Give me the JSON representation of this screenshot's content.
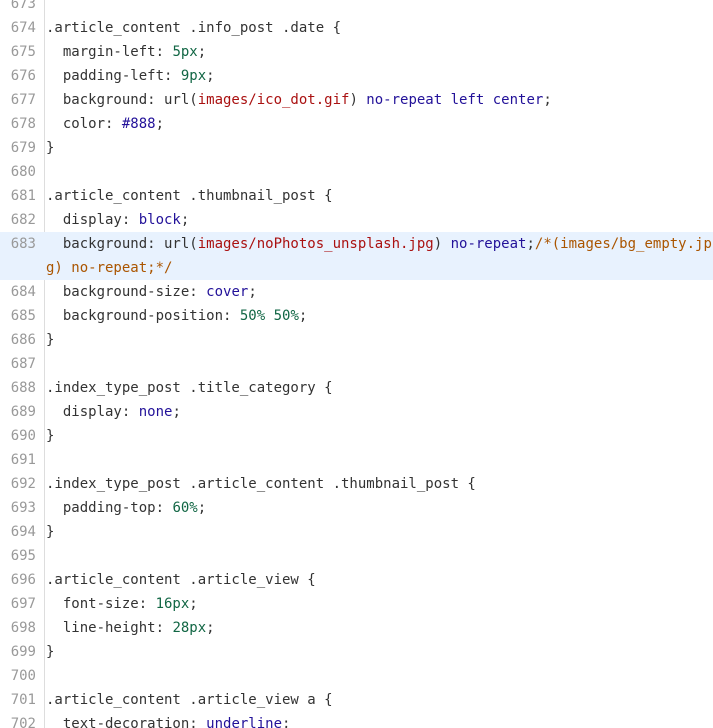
{
  "editor": {
    "colors": {
      "background": "#ffffff",
      "gutter_text": "#999999",
      "active_line": "#e8f2fe",
      "text": "#333333",
      "number": "#116644",
      "keyword": "#221199",
      "string": "#aa1111",
      "comment": "#aa5500"
    },
    "active_line_number": "683",
    "lines": [
      {
        "n": "673",
        "tokens": []
      },
      {
        "n": "674",
        "tokens": [
          {
            "t": ".article_content .info_post .date {",
            "c": "sel"
          }
        ]
      },
      {
        "n": "675",
        "tokens": [
          {
            "t": "  margin-left: ",
            "c": "prop"
          },
          {
            "t": "5px",
            "c": "num"
          },
          {
            "t": ";",
            "c": "punct"
          }
        ]
      },
      {
        "n": "676",
        "tokens": [
          {
            "t": "  padding-left: ",
            "c": "prop"
          },
          {
            "t": "9px",
            "c": "num"
          },
          {
            "t": ";",
            "c": "punct"
          }
        ]
      },
      {
        "n": "677",
        "tokens": [
          {
            "t": "  background: url(",
            "c": "prop"
          },
          {
            "t": "images/ico_dot.gif",
            "c": "str"
          },
          {
            "t": ") ",
            "c": "punct"
          },
          {
            "t": "no-repeat left center",
            "c": "kw"
          },
          {
            "t": ";",
            "c": "punct"
          }
        ]
      },
      {
        "n": "678",
        "tokens": [
          {
            "t": "  color: ",
            "c": "prop"
          },
          {
            "t": "#888",
            "c": "kw"
          },
          {
            "t": ";",
            "c": "punct"
          }
        ]
      },
      {
        "n": "679",
        "tokens": [
          {
            "t": "}",
            "c": "punct"
          }
        ]
      },
      {
        "n": "680",
        "tokens": []
      },
      {
        "n": "681",
        "tokens": [
          {
            "t": ".article_content .thumbnail_post {",
            "c": "sel"
          }
        ]
      },
      {
        "n": "682",
        "tokens": [
          {
            "t": "  display: ",
            "c": "prop"
          },
          {
            "t": "block",
            "c": "kw"
          },
          {
            "t": ";",
            "c": "punct"
          }
        ]
      },
      {
        "n": "683",
        "tokens": [
          {
            "t": "  background: url(",
            "c": "prop"
          },
          {
            "t": "images/noPhotos_unsplash.jpg",
            "c": "str"
          },
          {
            "t": ") ",
            "c": "punct"
          },
          {
            "t": "no-repeat",
            "c": "kw"
          },
          {
            "t": ";",
            "c": "punct"
          },
          {
            "t": "/*(images/bg_empty.jpg) no-repeat;*/",
            "c": "com"
          }
        ]
      },
      {
        "n": "684",
        "tokens": [
          {
            "t": "  background-size: ",
            "c": "prop"
          },
          {
            "t": "cover",
            "c": "kw"
          },
          {
            "t": ";",
            "c": "punct"
          }
        ]
      },
      {
        "n": "685",
        "tokens": [
          {
            "t": "  background-position: ",
            "c": "prop"
          },
          {
            "t": "50% 50%",
            "c": "num"
          },
          {
            "t": ";",
            "c": "punct"
          }
        ]
      },
      {
        "n": "686",
        "tokens": [
          {
            "t": "}",
            "c": "punct"
          }
        ]
      },
      {
        "n": "687",
        "tokens": []
      },
      {
        "n": "688",
        "tokens": [
          {
            "t": ".index_type_post .title_category {",
            "c": "sel"
          }
        ]
      },
      {
        "n": "689",
        "tokens": [
          {
            "t": "  display: ",
            "c": "prop"
          },
          {
            "t": "none",
            "c": "kw"
          },
          {
            "t": ";",
            "c": "punct"
          }
        ]
      },
      {
        "n": "690",
        "tokens": [
          {
            "t": "}",
            "c": "punct"
          }
        ]
      },
      {
        "n": "691",
        "tokens": []
      },
      {
        "n": "692",
        "tokens": [
          {
            "t": ".index_type_post .article_content .thumbnail_post {",
            "c": "sel"
          }
        ]
      },
      {
        "n": "693",
        "tokens": [
          {
            "t": "  padding-top: ",
            "c": "prop"
          },
          {
            "t": "60%",
            "c": "num"
          },
          {
            "t": ";",
            "c": "punct"
          }
        ]
      },
      {
        "n": "694",
        "tokens": [
          {
            "t": "}",
            "c": "punct"
          }
        ]
      },
      {
        "n": "695",
        "tokens": []
      },
      {
        "n": "696",
        "tokens": [
          {
            "t": ".article_content .article_view {",
            "c": "sel"
          }
        ]
      },
      {
        "n": "697",
        "tokens": [
          {
            "t": "  font-size: ",
            "c": "prop"
          },
          {
            "t": "16px",
            "c": "num"
          },
          {
            "t": ";",
            "c": "punct"
          }
        ]
      },
      {
        "n": "698",
        "tokens": [
          {
            "t": "  line-height: ",
            "c": "prop"
          },
          {
            "t": "28px",
            "c": "num"
          },
          {
            "t": ";",
            "c": "punct"
          }
        ]
      },
      {
        "n": "699",
        "tokens": [
          {
            "t": "}",
            "c": "punct"
          }
        ]
      },
      {
        "n": "700",
        "tokens": []
      },
      {
        "n": "701",
        "tokens": [
          {
            "t": ".article_content .article_view a {",
            "c": "sel"
          }
        ]
      },
      {
        "n": "702",
        "tokens": [
          {
            "t": "  text-decoration: ",
            "c": "prop"
          },
          {
            "t": "underline",
            "c": "kw"
          },
          {
            "t": ";",
            "c": "punct"
          }
        ]
      }
    ]
  }
}
